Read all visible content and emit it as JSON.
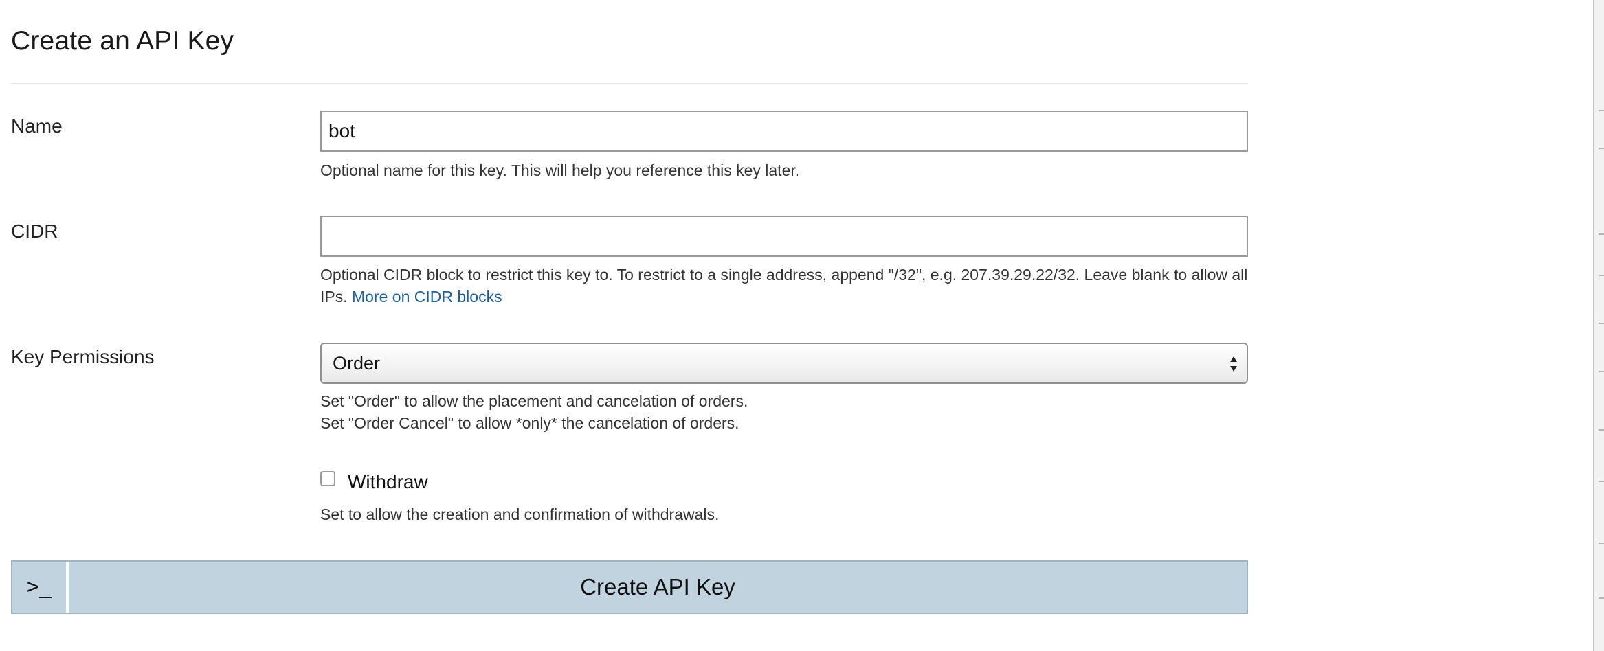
{
  "page": {
    "title": "Create an API Key"
  },
  "form": {
    "name": {
      "label": "Name",
      "value": "bot",
      "help": "Optional name for this key. This will help you reference this key later."
    },
    "cidr": {
      "label": "CIDR",
      "value": "",
      "help": "Optional CIDR block to restrict this key to. To restrict to a single address, append \"/32\", e.g. 207.39.29.22/32. Leave blank to allow all IPs.",
      "link_text": "More on CIDR blocks"
    },
    "permissions": {
      "label": "Key Permissions",
      "selected": "Order",
      "help_line1": "Set \"Order\" to allow the placement and cancelation of orders.",
      "help_line2": "Set \"Order Cancel\" to allow *only* the cancelation of orders."
    },
    "withdraw": {
      "label": "Withdraw",
      "checked": false,
      "help": "Set to allow the creation and confirmation of withdrawals."
    },
    "submit": {
      "prompt_icon": "terminal-prompt-icon",
      "prompt_glyph": ">_",
      "label": "Create API Key"
    }
  },
  "colors": {
    "submit_background": "#c2d3e0",
    "link": "#1a5fa5"
  }
}
